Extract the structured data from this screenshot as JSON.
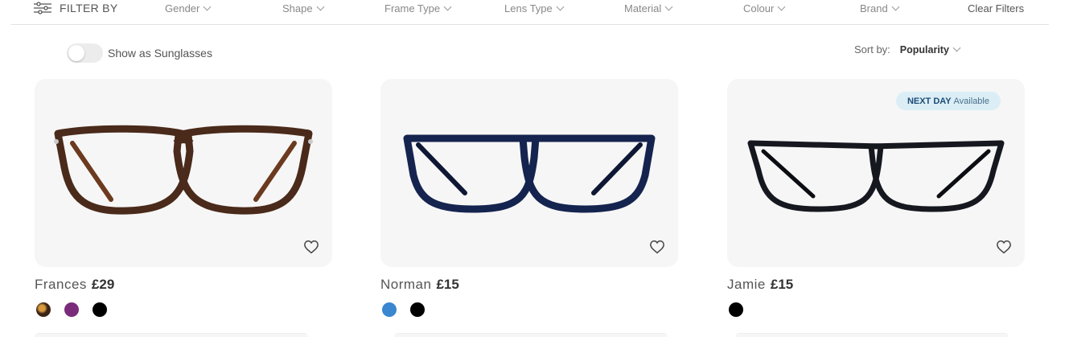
{
  "filter_bar": {
    "title": "FILTER BY",
    "filters": [
      "Gender",
      "Shape",
      "Frame Type",
      "Lens Type",
      "Material",
      "Colour",
      "Brand"
    ],
    "clear_label": "Clear Filters"
  },
  "toggle": {
    "label": "Show as Sunglasses",
    "on": false
  },
  "sort": {
    "label": "Sort by:",
    "value": "Popularity"
  },
  "products": [
    {
      "name": "Frances",
      "price": "£29",
      "frame_color": "#4a2a1a",
      "swatches": [
        "#3b2416",
        "#7a2c7a",
        "#000000"
      ]
    },
    {
      "name": "Norman",
      "price": "£15",
      "frame_color": "#15234f",
      "swatches": [
        "#3a86cf",
        "#000000"
      ]
    },
    {
      "name": "Jamie",
      "price": "£15",
      "frame_color": "#15181f",
      "swatches": [
        "#000000"
      ],
      "badge": {
        "strong": "NEXT DAY",
        "text": "Available"
      }
    }
  ]
}
